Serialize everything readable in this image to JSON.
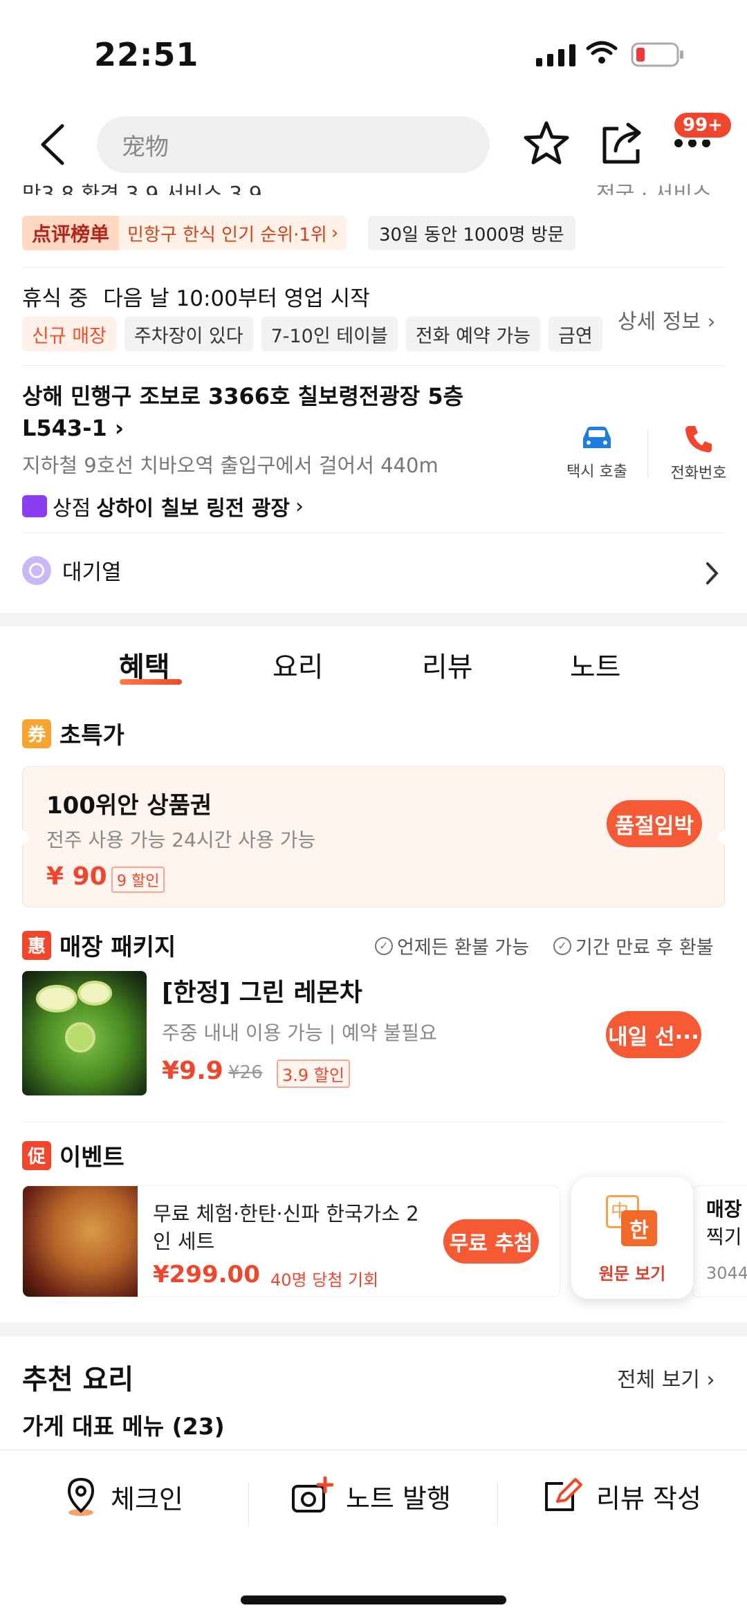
{
  "status_bar": {
    "time": "22:51"
  },
  "nav": {
    "search_placeholder": "宠物",
    "more_badge": "99+"
  },
  "ratings_cut": {
    "left": "맛3.8  환경 3.9  서비스 3.9",
    "right": "전국 · 서비스"
  },
  "rank": {
    "logo": "点评榜单",
    "text": "민항구 한식 인기 순위·1위",
    "visits": "30일 동안 1000명 방문"
  },
  "hours": {
    "status": "휴식 중",
    "text": "다음 날 10:00부터 영업 시작"
  },
  "tags": [
    "신규 매장",
    "주차장이 있다",
    "7-10인 테이블",
    "전화 예약 가능",
    "금연"
  ],
  "detail_link": "상세 정보",
  "address": {
    "line": "상해 민행구 조보로 3366호 칠보령전광장 5층 L543-1",
    "metro": "지하철 9호선 치바오역 출입구에서 걸어서 440m",
    "mall_label": "상점",
    "mall_name": "상하이 칠보 링전 광장"
  },
  "actions": {
    "taxi": "택시 호출",
    "phone": "전화번호"
  },
  "queue": {
    "label": "대기열"
  },
  "tabs": [
    "혜택",
    "요리",
    "리뷰",
    "노트"
  ],
  "special": {
    "icon": "券",
    "title": "초특가",
    "voucher": {
      "name": "100위안 상품권",
      "desc": "전주 사용 가능 24시간 사용 가능",
      "price": "¥ 90",
      "discount": "9 할인",
      "button": "품절임박"
    }
  },
  "package": {
    "icon": "惠",
    "title": "매장 패키지",
    "refund1": "언제든 환불 가능",
    "refund2": "기간 만료 후 환불",
    "item": {
      "name": "[한정] 그린 레몬차",
      "desc": "주중 내내 이용 가능 | 예약 불필요",
      "price": "¥9.9",
      "original": "¥26",
      "discount": "3.9 할인",
      "button": "내일 선···"
    }
  },
  "event": {
    "icon": "促",
    "title": "이벤트",
    "item": {
      "name": "무료 체험·한탄·신파 한국가소 2인 세트",
      "price": "¥299.00",
      "winners": "40명 당첨 기회",
      "button": "무료 추첨"
    },
    "translate": {
      "zh": "中",
      "ko": "한",
      "label": "원문 보기"
    },
    "peek": {
      "line1": "매장",
      "line2": "찍기",
      "line3": "3044"
    }
  },
  "recommend": {
    "title": "추천 요리",
    "all": "전체 보기",
    "sub": "가게 대표 메뉴 (23)"
  },
  "bottom_bar": {
    "checkin": "체크인",
    "note": "노트 발행",
    "review": "리뷰 작성"
  },
  "colors": {
    "accent": "#f0462d",
    "button": "#f55a35",
    "purple": "#8b3df0",
    "blue": "#1e7be0"
  }
}
